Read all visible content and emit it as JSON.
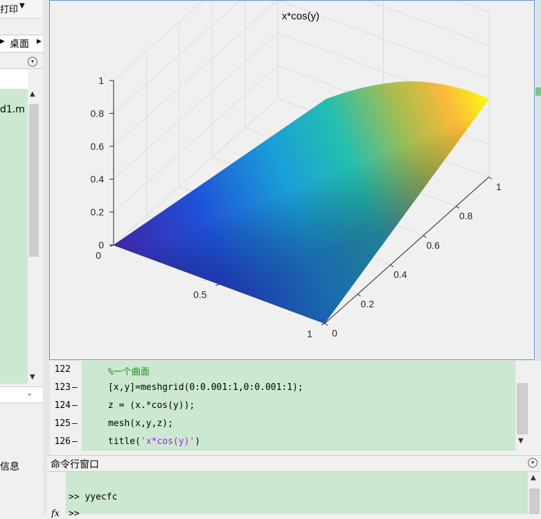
{
  "toolbar": {
    "print_label": "打印",
    "menu_arrow": "▼"
  },
  "path": {
    "arrow": "▶",
    "desktop": "桌面"
  },
  "left_panel": {
    "collapse_glyph": "▾",
    "file_name": "d1.m",
    "scroll_up": "▲",
    "scroll_down": "▼",
    "details_glyph": "⌄",
    "info_label": "信息"
  },
  "figure": {
    "title": "x*cos(y)",
    "colors": {
      "low": "#3e26a8",
      "mid": "#1a9ed8",
      "high": "#f9fb0e",
      "grid": "#dcdcdc",
      "axis": "#262626"
    }
  },
  "chart_data": {
    "type": "surface",
    "title": "x*cos(y)",
    "function": "z = x.*cos(y)",
    "x_ticks": [
      "0",
      "0.2",
      "0.4",
      "0.6",
      "0.8",
      "1"
    ],
    "y_ticks": [
      "0",
      "0.5",
      "1"
    ],
    "z_ticks": [
      "0",
      "0.2",
      "0.4",
      "0.6",
      "0.8",
      "1"
    ],
    "xlim": [
      0,
      1
    ],
    "ylim": [
      0,
      1
    ],
    "zlim": [
      0,
      1
    ],
    "grid": true,
    "colormap": "parula"
  },
  "editor": {
    "lines": [
      {
        "num": "122",
        "marker": "",
        "code": "%一个曲面",
        "kind": "comment"
      },
      {
        "num": "123",
        "marker": "—",
        "code": "[x,y]=meshgrid(0:0.001:1,0:0.001:1);",
        "kind": "code"
      },
      {
        "num": "124",
        "marker": "—",
        "code": "z = (x.*cos(y));",
        "kind": "code"
      },
      {
        "num": "125",
        "marker": "—",
        "code": "mesh(x,y,z);",
        "kind": "code"
      },
      {
        "num": "126",
        "marker": "—",
        "code_prefix": "title(",
        "code_str": "'x*cos(y)'",
        "code_suffix": ")",
        "kind": "mixed"
      }
    ],
    "scroll_down": "▼"
  },
  "command_window": {
    "title": "命令行窗口",
    "line1": ">> yyecfc",
    "line2": ">>",
    "fx": "fx",
    "collapse_glyph": "▾",
    "scroll_up": "▲"
  }
}
